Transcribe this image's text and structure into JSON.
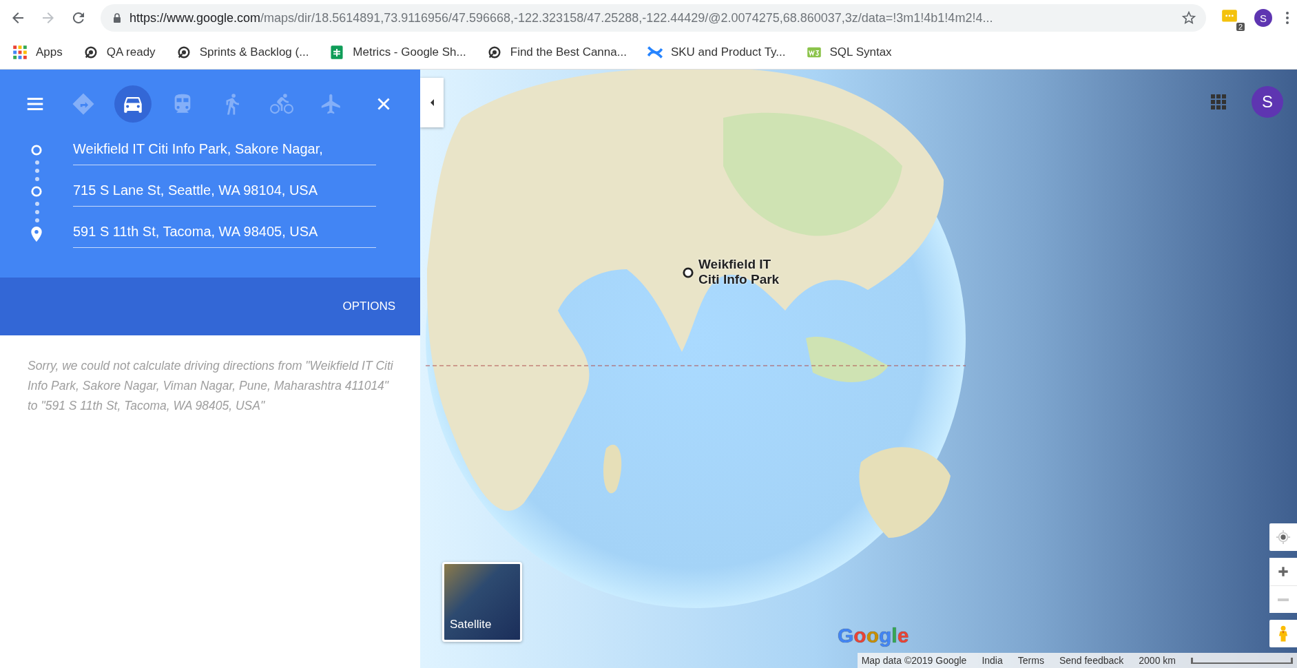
{
  "browser": {
    "url_host": "https://www.google.com",
    "url_path": "/maps/dir/18.5614891,73.9116956/47.596668,-122.323158/47.25288,-122.44429/@2.0074275,68.860037,3z/data=!3m1!4b1!4m2!4...",
    "extension_badge": "2",
    "profile_initial": "S"
  },
  "bookmarks": [
    {
      "label": "Apps",
      "kind": "apps"
    },
    {
      "label": "QA ready",
      "kind": "site"
    },
    {
      "label": "Sprints & Backlog (...",
      "kind": "site"
    },
    {
      "label": "Metrics - Google Sh...",
      "kind": "sheets"
    },
    {
      "label": "Find the Best Canna...",
      "kind": "site"
    },
    {
      "label": "SKU and Product Ty...",
      "kind": "confluence"
    },
    {
      "label": "SQL Syntax",
      "kind": "w3"
    }
  ],
  "directions": {
    "modes": [
      {
        "kind": "best",
        "selected": false
      },
      {
        "kind": "car",
        "selected": true
      },
      {
        "kind": "train",
        "selected": false
      },
      {
        "kind": "walk",
        "selected": false
      },
      {
        "kind": "bike",
        "selected": false
      },
      {
        "kind": "plane",
        "selected": false
      }
    ],
    "waypoints": [
      {
        "kind": "origin",
        "value": "Weikfield IT Citi Info Park, Sakore Nagar,"
      },
      {
        "kind": "stop",
        "value": "715 S Lane St, Seattle, WA 98104, USA"
      },
      {
        "kind": "destination",
        "value": "591 S 11th St, Tacoma, WA 98405, USA"
      }
    ],
    "options_label": "OPTIONS",
    "message": "Sorry, we could not calculate driving directions from \"Weikfield IT Citi Info Park, Sakore Nagar, Viman Nagar, Pune, Maharashtra 411014\" to \"591 S 11th St, Tacoma, WA 98405, USA\""
  },
  "map": {
    "marker_label": "Weikfield IT Citi Info Park",
    "profile_initial": "S",
    "satellite_label": "Satellite",
    "logo": "Google",
    "footer": [
      "Map data ©2019 Google",
      "India",
      "Terms",
      "Send feedback"
    ],
    "scale": "2000 km"
  }
}
